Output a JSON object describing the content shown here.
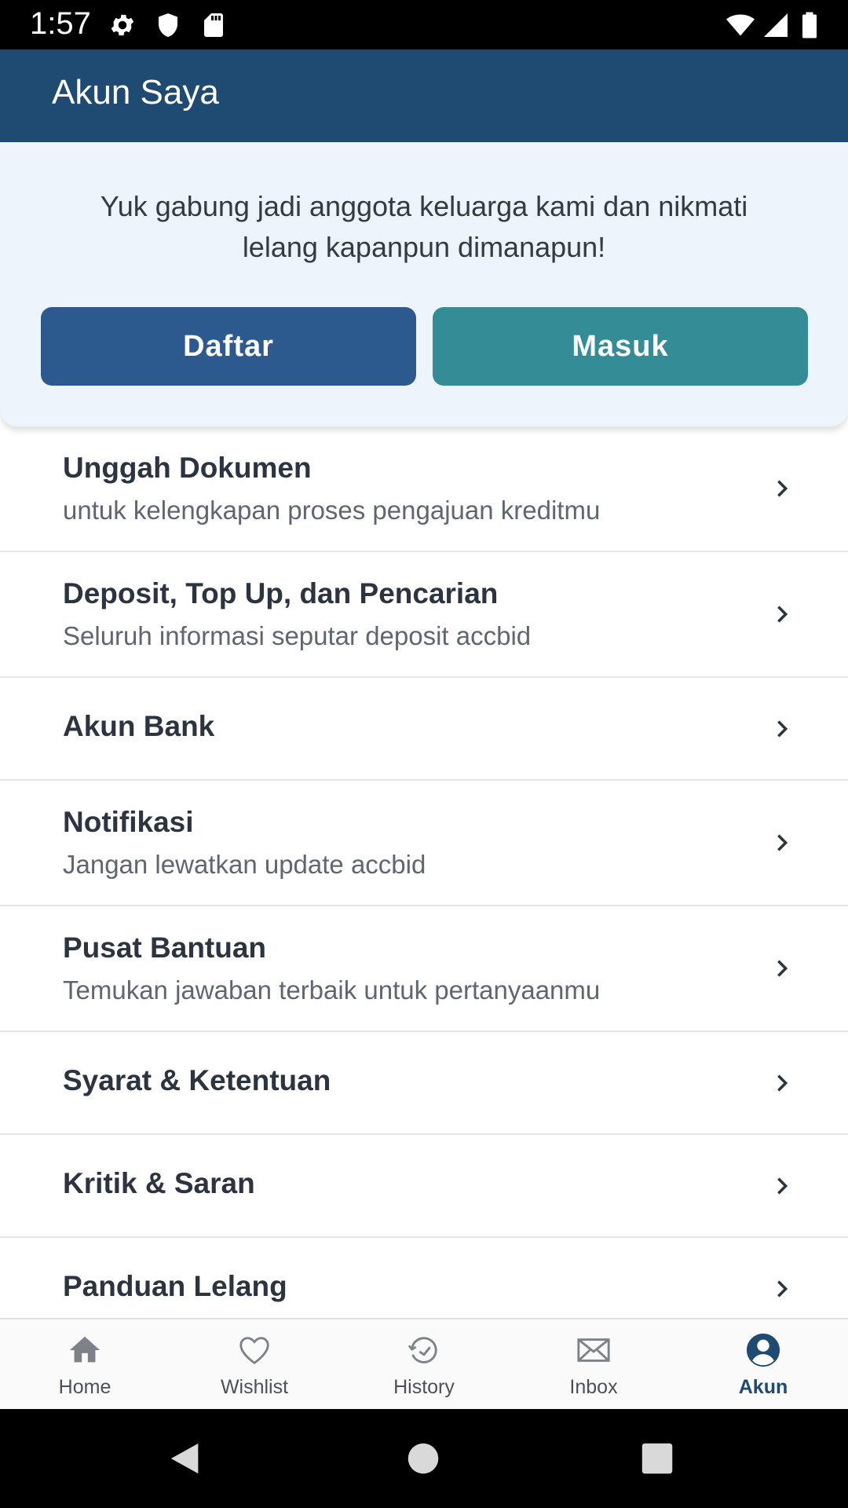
{
  "status_bar": {
    "time": "1:57",
    "left_icons": [
      "settings-icon",
      "shield-icon",
      "sd-card-icon"
    ],
    "right_icons": [
      "wifi-icon",
      "signal-icon",
      "battery-icon"
    ]
  },
  "app_bar": {
    "title": "Akun Saya"
  },
  "promo": {
    "message": "Yuk gabung jadi anggota keluarga kami dan nikmati lelang kapanpun dimanapun!",
    "register_label": "Daftar",
    "login_label": "Masuk",
    "register_color": "#2d5a8e",
    "login_color": "#348d96"
  },
  "menu": [
    {
      "title": "Unggah Dokumen",
      "subtitle": "untuk kelengkapan proses pengajuan kreditmu"
    },
    {
      "title": "Deposit, Top Up, dan Pencarian",
      "subtitle": "Seluruh informasi seputar deposit accbid"
    },
    {
      "title": "Akun Bank",
      "subtitle": ""
    },
    {
      "title": "Notifikasi",
      "subtitle": "Jangan lewatkan update accbid"
    },
    {
      "title": "Pusat Bantuan",
      "subtitle": "Temukan jawaban terbaik untuk pertanyaanmu"
    },
    {
      "title": "Syarat & Ketentuan",
      "subtitle": ""
    },
    {
      "title": "Kritik & Saran",
      "subtitle": ""
    },
    {
      "title": "Panduan Lelang",
      "subtitle": ""
    }
  ],
  "bottom_nav": [
    {
      "label": "Home",
      "icon": "home-icon",
      "active": false
    },
    {
      "label": "Wishlist",
      "icon": "heart-icon",
      "active": false
    },
    {
      "label": "History",
      "icon": "history-icon",
      "active": false
    },
    {
      "label": "Inbox",
      "icon": "mail-icon",
      "active": false
    },
    {
      "label": "Akun",
      "icon": "account-icon",
      "active": true
    }
  ],
  "colors": {
    "app_bar": "#1f4a72",
    "active_tab": "#1f4a72"
  }
}
